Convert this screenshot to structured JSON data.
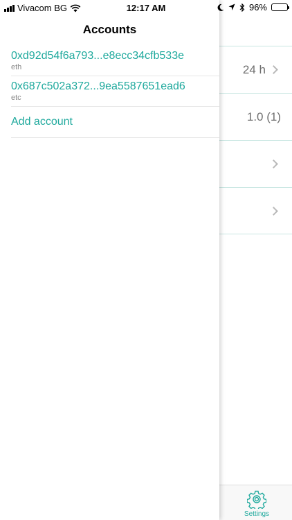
{
  "status_bar": {
    "carrier": "Vivacom BG",
    "time": "12:17 AM",
    "battery_percent": "96%",
    "battery_level": 0.96
  },
  "drawer": {
    "title": "Accounts",
    "accounts": [
      {
        "address": "0xd92d54f6a793...e8ecc34cfb533e",
        "network": "eth"
      },
      {
        "address": "0x687c502a372...9ea5587651ead6",
        "network": "etc"
      }
    ],
    "add_account_label": "Add account"
  },
  "settings": {
    "rows": [
      {
        "value": "24 h",
        "chevron": true
      },
      {
        "value": "1.0 (1)",
        "chevron": false
      },
      {
        "value": "",
        "chevron": true
      },
      {
        "value": "",
        "chevron": true
      }
    ]
  },
  "tab_bar": {
    "settings_label": "Settings"
  },
  "colors": {
    "accent": "#1fa99d",
    "secondary_text": "#8a8a8a",
    "separator": "#c8e6e2"
  }
}
